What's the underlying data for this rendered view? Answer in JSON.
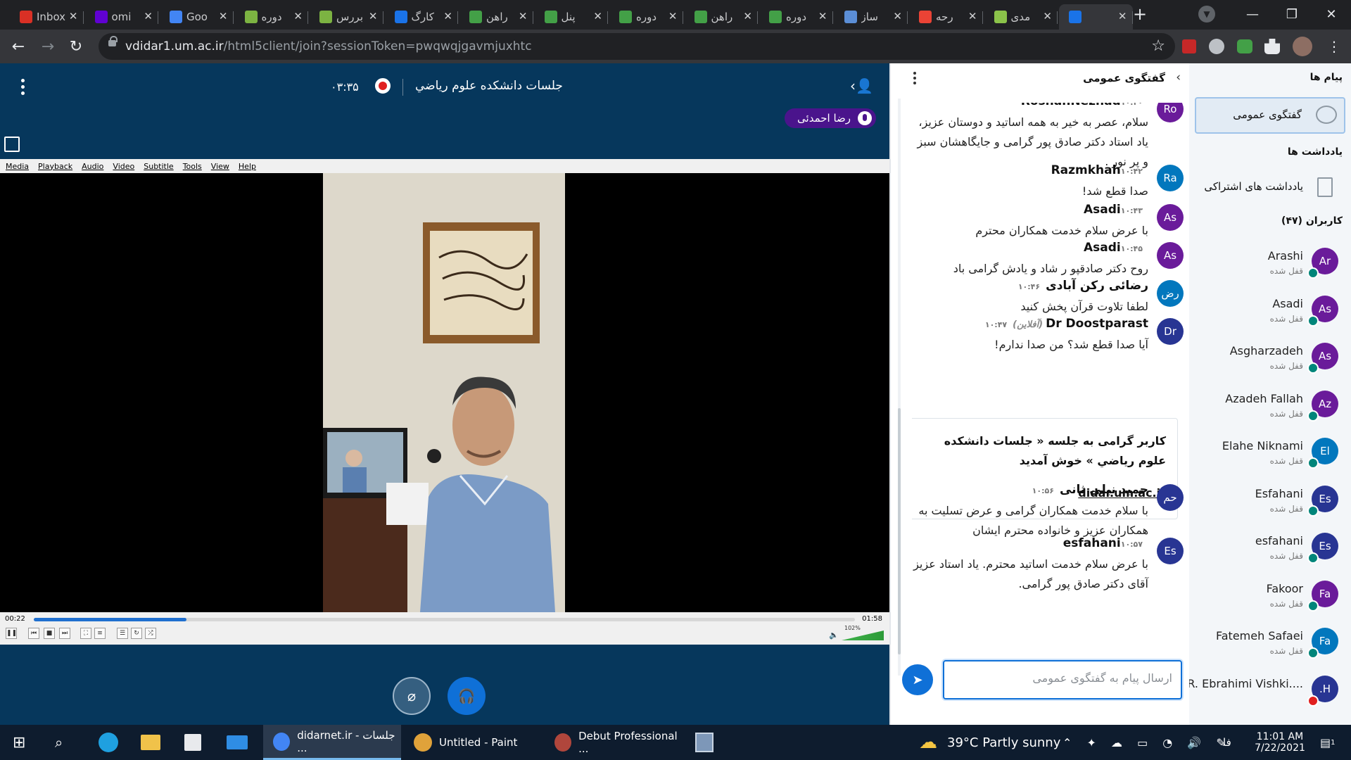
{
  "browser": {
    "tabs": [
      {
        "title": "Inbox",
        "color": "#d93025"
      },
      {
        "title": "omi",
        "color": "#6001d2"
      },
      {
        "title": "Goo",
        "color": "#4285f4"
      },
      {
        "title": "دوره",
        "color": "#7cb342"
      },
      {
        "title": "بررس",
        "color": "#7cb342"
      },
      {
        "title": "کارگ",
        "color": "#1a73e8"
      },
      {
        "title": "راهن",
        "color": "#43a047"
      },
      {
        "title": "پنل",
        "color": "#43a047"
      },
      {
        "title": "دوره",
        "color": "#43a047"
      },
      {
        "title": "راهن",
        "color": "#43a047"
      },
      {
        "title": "دوره",
        "color": "#43a047"
      },
      {
        "title": "ساز",
        "color": "#5b8ed6"
      },
      {
        "title": "رحه",
        "color": "#ea4335"
      },
      {
        "title": "مدی",
        "color": "#8bc34a"
      },
      {
        "title": "",
        "color": "#1a73e8"
      }
    ],
    "url_host": "vdidar1.um.ac.ir",
    "url_path": "/html5client/join?sessionToken=pwqwqjgavmjuxhtc"
  },
  "meeting": {
    "title": "جلسات دانشکده علوم رياضي",
    "recording_time": "۰۳:۳۵",
    "talker": "رضا احمدئی"
  },
  "vlc": {
    "menu": [
      "Media",
      "Playback",
      "Audio",
      "Video",
      "Subtitle",
      "Tools",
      "View",
      "Help"
    ],
    "elapsed": "00:22",
    "duration": "01:58",
    "progress": 0.186,
    "volume_label": "102%"
  },
  "chat": {
    "title": "گفتگوی عمومی",
    "input_placeholder": "ارسال پیام به گفتگوی عمومی",
    "messages": [
      {
        "initials": "Ro",
        "name": "RoshanNezhad",
        "time": "۱۰:۴۰",
        "text": "سلام، عصر به خیر به همه اساتید و دوستان عزیز، یاد استاد دکتر صادق پور گرامی و جایگاهشان سبز و پر نور .",
        "color": "#6a1b9a"
      },
      {
        "initials": "Ra",
        "name": "Razmkhah",
        "time": "۱۰:۴۲",
        "text": "صدا قطع شد!",
        "color": "#0277bd"
      },
      {
        "initials": "As",
        "name": "Asadi",
        "time": "۱۰:۴۳",
        "text": "با عرض سلام خدمت همکاران محترم",
        "color": "#6a1b9a"
      },
      {
        "initials": "As",
        "name": "Asadi",
        "time": "۱۰:۴۵",
        "text": "روح دکتر صادقپو ر شاد و یادش گرامی باد",
        "color": "#6a1b9a"
      },
      {
        "initials": "رض",
        "name": "رضائی رکن آبادی",
        "time": "۱۰:۴۶",
        "text": "لطفا تلاوت قرآن پخش کنید",
        "color": "#0277bd"
      },
      {
        "initials": "Dr",
        "name": "Dr Doostparast",
        "offline": "(آفلاین)",
        "time": "۱۰:۴۷",
        "text": "آیا صدا قطع شد؟ من صدا ندارم!",
        "color": "#283593"
      },
      {
        "initials": "حم",
        "name": "حمید نیلی ثانی",
        "time": "۱۰:۵۶",
        "text": "با سلام خدمت همکاران گرامی و عرض تسلیت به همکاران عزیز و خانواده محترم ایشان",
        "color": "#283593"
      },
      {
        "initials": "Es",
        "name": "esfahani",
        "time": "۱۰:۵۷",
        "text": "با عرض سلام خدمت اساتید محترم. یاد استاد عزیز آقای دکتر صادق پور گرامی.",
        "color": "#283593"
      }
    ],
    "welcome_line1": "کاربر گرامی به جلسه « جلسات دانشکده علوم رياضي » خوش آمدید",
    "welcome_link": "didar.um.ac.ir"
  },
  "sidebar": {
    "messages_heading": "پیام ها",
    "public_chat": "گفتگوی عمومی",
    "notes_heading": "یادداشت ها",
    "shared_notes": "یادداشت های اشتراکی",
    "users_heading": "کاربران (۴۷)",
    "locked": "قفل شده",
    "users": [
      {
        "initials": "Ar",
        "name": "Arashi",
        "color": "#6a1b9a"
      },
      {
        "initials": "As",
        "name": "Asadi",
        "color": "#6a1b9a"
      },
      {
        "initials": "As",
        "name": "Asgharzadeh",
        "color": "#6a1b9a"
      },
      {
        "initials": "Az",
        "name": "Azadeh Fallah",
        "color": "#6a1b9a"
      },
      {
        "initials": "El",
        "name": "Elahe Niknami",
        "color": "#0277bd"
      },
      {
        "initials": "Es",
        "name": "Esfahani",
        "color": "#283593"
      },
      {
        "initials": "Es",
        "name": "esfahani",
        "color": "#283593"
      },
      {
        "initials": "Fa",
        "name": "Fakoor",
        "color": "#6a1b9a"
      },
      {
        "initials": "Fa",
        "name": "Fatemeh Safaei",
        "color": "#0277bd"
      },
      {
        "initials": "H.",
        "name": "R. Ebrahimi Vishki....",
        "color": "#283593"
      }
    ]
  },
  "taskbar": {
    "apps": [
      {
        "label": "didarnet.ir - جلسات ...",
        "color": "#4285f4"
      },
      {
        "label": "Untitled - Paint",
        "color": "#e0a23a"
      },
      {
        "label": "Debut Professional ...",
        "color": "#b0463c"
      }
    ],
    "weather": "39°C Partly sunny",
    "lang": "فا",
    "time": "11:01 AM",
    "date": "7/22/2021",
    "notification_count": "1"
  }
}
